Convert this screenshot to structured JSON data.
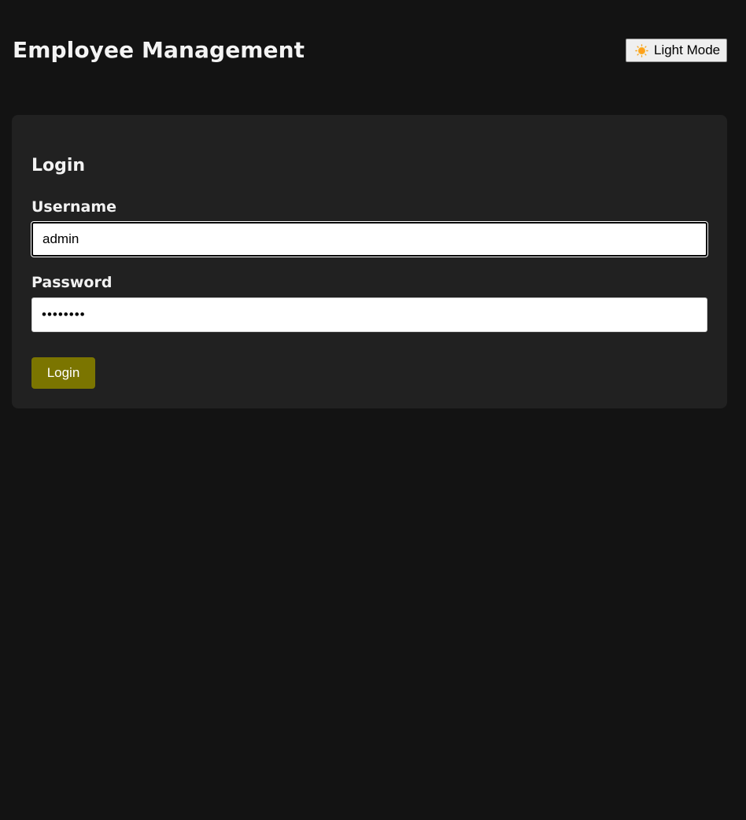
{
  "header": {
    "title": "Employee Management",
    "theme_toggle": {
      "icon": "sun-icon",
      "label": "Light Mode"
    }
  },
  "login": {
    "title": "Login",
    "username": {
      "label": "Username",
      "value": "admin"
    },
    "password": {
      "label": "Password",
      "value": "password"
    },
    "submit_label": "Login"
  },
  "colors": {
    "page_background": "#131313",
    "card_background": "#212121",
    "accent_button": "#7b7500",
    "text": "#f2f2f2"
  }
}
